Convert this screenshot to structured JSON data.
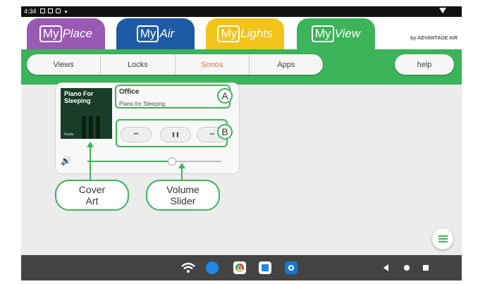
{
  "status_bar": {
    "time": "4:34"
  },
  "app_tabs": [
    {
      "my": "My",
      "name": "Place",
      "color": "#9b59b6"
    },
    {
      "my": "My",
      "name": "Air",
      "color": "#1f5aa6"
    },
    {
      "my": "My",
      "name": "Lights",
      "color": "#f2c318"
    },
    {
      "my": "My",
      "name": "View",
      "color": "#3cb45a"
    }
  ],
  "brand": "by ADVANTAGE AIR",
  "sub_tabs": [
    "Views",
    "Locks",
    "Sonos",
    "Apps"
  ],
  "active_sub_tab": "Sonos",
  "help_label": "help",
  "player": {
    "album_art_title": "Piano For Sleeping",
    "album_art_caption": "Nuala",
    "room": "Office",
    "track": "Piano for Sleeping",
    "volume_fraction": 0.63
  },
  "annotations": {
    "a": "A",
    "b": "B",
    "cover_art_line1": "Cover",
    "cover_art_line2": "Art",
    "volume_line1": "Volume",
    "volume_line2": "Slider"
  },
  "icons": {
    "prev": "skip-previous-icon",
    "pause": "pause-icon",
    "next": "skip-next-icon",
    "speaker": "speaker-icon",
    "menu": "menu-icon"
  }
}
